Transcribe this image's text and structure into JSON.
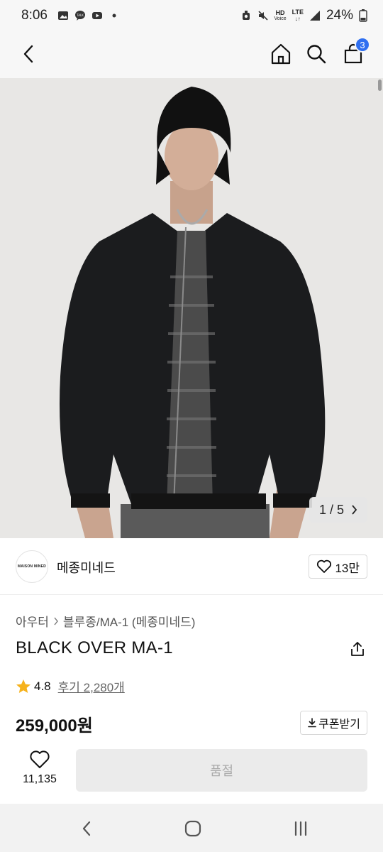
{
  "status_bar": {
    "time": "8:06",
    "network_hd": "HD",
    "network_voice": "Voice",
    "network_lte": "LTE",
    "battery": "24%"
  },
  "nav": {
    "cart_count": "3"
  },
  "image": {
    "counter": "1 / 5"
  },
  "brand": {
    "logo_text": "MAISON MINED",
    "name": "메종미네드",
    "likes": "13만"
  },
  "product": {
    "breadcrumb": [
      "아우터",
      "블루종/MA-1 (메종미네드)"
    ],
    "title": "BLACK OVER MA-1",
    "rating": "4.8",
    "reviews": "후기 2,280개",
    "price": "259,000원",
    "coupon_label": "쿠폰받기"
  },
  "actions": {
    "wish_count": "11,135",
    "soldout_label": "품절"
  },
  "colors": {
    "accent": "#2f6ff0",
    "star": "#f6b21c"
  }
}
